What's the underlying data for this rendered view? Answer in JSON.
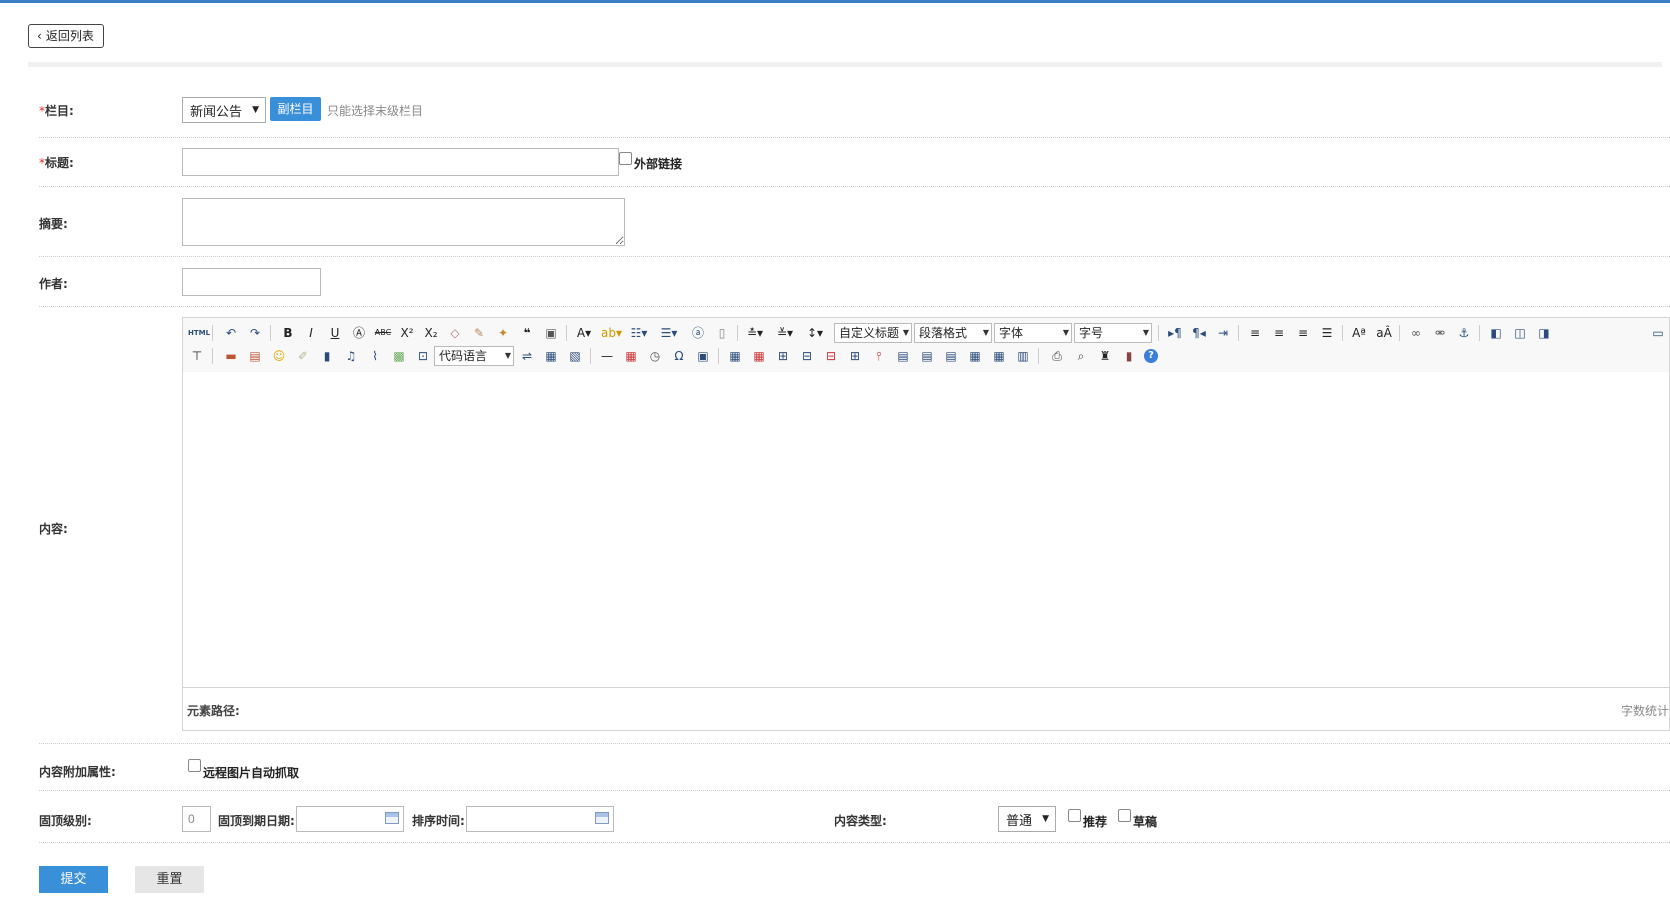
{
  "header": {
    "back_label": "返回列表"
  },
  "form": {
    "required_mark": "*",
    "column": {
      "label": "栏目:",
      "selected": "新闻公告",
      "sub_button": "副栏目",
      "hint": "只能选择末级栏目"
    },
    "title": {
      "label": "标题:",
      "value": "",
      "external_link_label": "外部链接"
    },
    "summary": {
      "label": "摘要:",
      "value": ""
    },
    "author": {
      "label": "作者:",
      "value": ""
    },
    "content": {
      "label": "内容:",
      "toolbar": {
        "custom_heading": "自定义标题",
        "paragraph_format": "段落格式",
        "font_family": "字体",
        "font_size": "字号",
        "code_language": "代码语言",
        "icons": [
          "html-icon",
          "undo-icon",
          "redo-icon",
          "bold-icon",
          "italic-icon",
          "underline-icon",
          "font-border-icon",
          "strikethrough-icon",
          "superscript-icon",
          "subscript-icon",
          "eraser-icon",
          "format-brush-icon",
          "auto-format-icon",
          "blockquote-icon",
          "paste-text-icon",
          "font-color-icon",
          "background-color-icon",
          "ordered-list-icon",
          "unordered-list-icon",
          "select-all-icon",
          "clear-doc-icon",
          "row-spacing-top-icon",
          "row-spacing-bottom-icon",
          "line-height-icon",
          "ltr-icon",
          "rtl-icon",
          "indent-icon",
          "align-left-icon",
          "align-center-icon",
          "align-right-icon",
          "justify-icon",
          "uppercase-icon",
          "lowercase-icon",
          "link-icon",
          "unlink-icon",
          "anchor-icon",
          "image-left-icon",
          "image-center-icon",
          "image-right-icon",
          "image-none-icon",
          "horizontal-rule-icon",
          "insert-image-icon",
          "multi-image-icon",
          "emoticon-icon",
          "scrawl-icon",
          "video-icon",
          "music-icon",
          "attachment-icon",
          "map-icon",
          "code-icon",
          "page-break-icon",
          "template-icon",
          "background-icon",
          "separator-line-icon",
          "date-icon",
          "time-icon",
          "special-char-icon",
          "word-image-icon",
          "insert-table-icon",
          "delete-table-icon",
          "insert-paragraph-before-table-icon",
          "insert-row-icon",
          "delete-row-icon",
          "insert-col-icon",
          "delete-col-icon",
          "merge-cells-icon",
          "merge-right-icon",
          "merge-down-icon",
          "split-cells-icon",
          "split-rows-icon",
          "split-cols-icon",
          "print-icon",
          "preview-icon",
          "search-replace-icon",
          "drafts-icon",
          "help-icon"
        ]
      },
      "status_path_label": "元素路径:",
      "word_count_label": "字数统计"
    },
    "extra_attrs": {
      "label": "内容附加属性:",
      "remote_image_label": "远程图片自动抓取"
    },
    "top_level": {
      "label": "固顶级别:",
      "value": "0",
      "expiry_label": "固顶到期日期:",
      "sort_time_label": "排序时间:",
      "content_type_label": "内容类型:",
      "content_type_selected": "普通",
      "recommend_label": "推荐",
      "draft_label": "草稿"
    },
    "actions": {
      "submit": "提交",
      "reset": "重置"
    }
  },
  "colors": {
    "accent": "#3a8fd9",
    "required": "#e0292b",
    "topbar": "#3a7fc6"
  }
}
